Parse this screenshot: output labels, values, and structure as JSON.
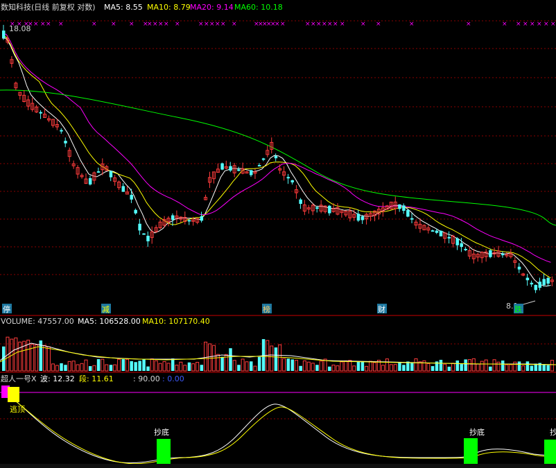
{
  "header": {
    "title": "数知科技(日线 前复权 对数)",
    "ma5": "MA5: 8.55",
    "ma10": "MA10: 8.79",
    "ma20": "MA20: 9.14",
    "ma60": "MA60: 10.18",
    "high_label": "18.08",
    "low_label": "8.1"
  },
  "volume_header": {
    "volume": "VOLUME: 47557.00",
    "ma5": "MA5: 106528.00",
    "ma10": "MA10: 107170.40"
  },
  "indicator_header": {
    "name": "超人一号X",
    "wave": "波: 12.32",
    "segment": "段: 11.61",
    "v3": ": 90.00",
    "v4": ": 0.00"
  },
  "markers": [
    "停",
    "减",
    "榜",
    "财",
    "跌"
  ],
  "indicator_labels": {
    "escape": "逃顶",
    "bottom1": "抄底",
    "bottom2": "抄底",
    "bottom3": "抄"
  },
  "colors": {
    "up": "#ff3c3c",
    "down": "#54fcfc",
    "ma5": "#ffffff",
    "ma10": "#ffff00",
    "ma20": "#ff00ff",
    "ma60": "#00ff00",
    "grid": "#8b0000"
  },
  "chart_data": [
    {
      "type": "candlestick",
      "scale": "log",
      "series": [
        {
          "name": "MA5",
          "value": 8.55
        },
        {
          "name": "MA10",
          "value": 8.79
        },
        {
          "name": "MA20",
          "value": 9.14
        },
        {
          "name": "MA60",
          "value": 10.18
        }
      ],
      "high": 18.08,
      "low": 8.1,
      "grid": true
    },
    {
      "type": "bar",
      "series": [
        {
          "name": "VOLUME",
          "value": 47557.0
        },
        {
          "name": "MA5",
          "value": 106528.0
        },
        {
          "name": "MA10",
          "value": 107170.4
        }
      ]
    },
    {
      "type": "line",
      "series": [
        {
          "name": "波",
          "value": 12.32
        },
        {
          "name": "段",
          "value": 11.61
        }
      ]
    }
  ]
}
